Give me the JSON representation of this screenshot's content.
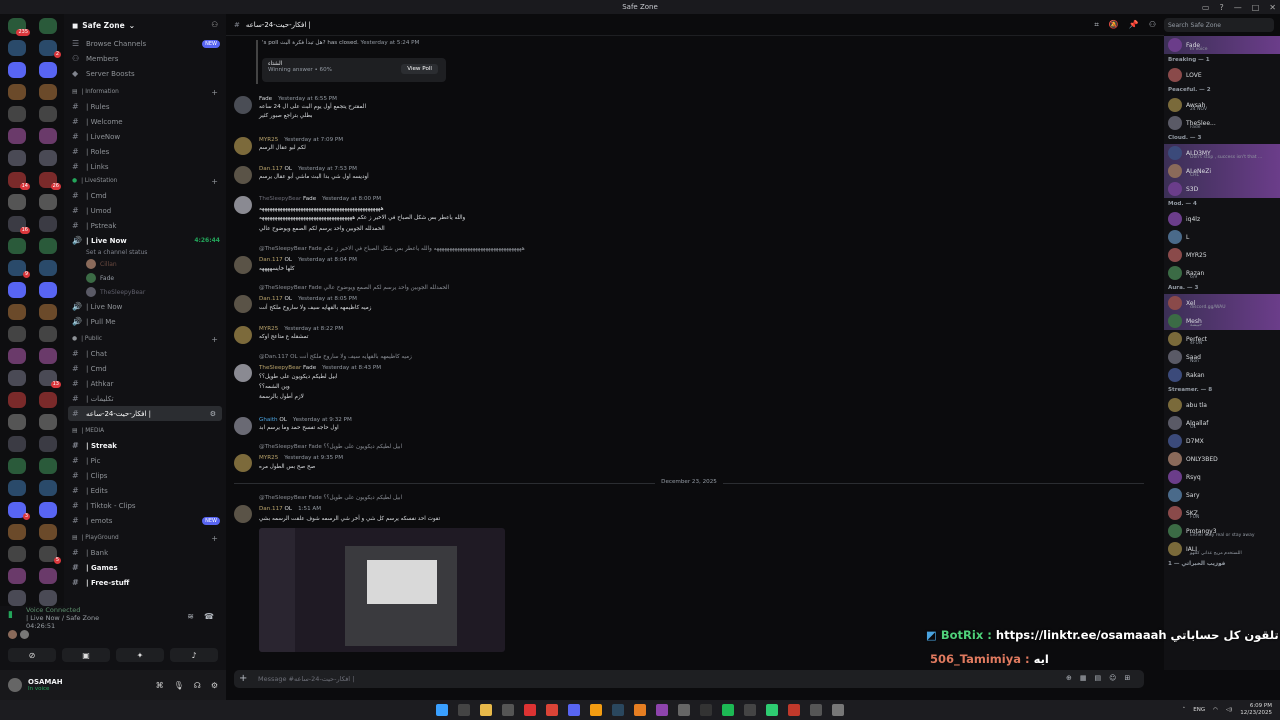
{
  "window": {
    "title": "Safe Zone"
  },
  "servers": {
    "col1_badges": [
      "235",
      "",
      "",
      "",
      "",
      "",
      "",
      "14",
      "",
      "16",
      "",
      "9",
      "",
      "",
      "",
      "",
      "",
      "",
      "",
      "",
      "",
      "",
      "3",
      "",
      "",
      "",
      "",
      "",
      "",
      "",
      "",
      "",
      "",
      "",
      "",
      "",
      "",
      "NEW"
    ],
    "col2_badges": [
      "",
      "2",
      "",
      "",
      "",
      "",
      "",
      "26",
      "",
      "",
      "",
      "",
      "",
      "",
      "",
      "",
      "13",
      "",
      "",
      "",
      "",
      "",
      "",
      "",
      "5",
      "",
      "",
      "",
      "",
      "",
      "",
      "",
      "",
      "",
      "",
      "",
      "",
      ""
    ]
  },
  "sidebar": {
    "guild_name": "Safe Zone",
    "top_items": [
      {
        "label": "Browse Channels",
        "badge": "NEW"
      },
      {
        "label": "Members",
        "badge": ""
      },
      {
        "label": "Server Boosts",
        "badge": ""
      }
    ],
    "categories": [
      {
        "name": "| Information",
        "channels": [
          "| Rules",
          "| Welcome",
          "| LiveNow",
          "| Roles",
          "| Links"
        ]
      },
      {
        "name": "| LiveStation",
        "channels": [
          "| Cmd",
          "| Umod",
          "| Pstreak"
        ]
      },
      {
        "name": "| Public",
        "channels": [
          "| Chat",
          "| Cmd",
          "| Athkar",
          "| تكليمات"
        ]
      },
      {
        "name": "| MEDIA",
        "channels": [
          "| Streak",
          "| Pic",
          "| Clips",
          "| Edits",
          "| Tiktok - Clips",
          "| emots"
        ]
      },
      {
        "name": "| PlayGround",
        "channels": [
          "| Bank",
          "| Games",
          "| Free-stuff"
        ]
      }
    ],
    "live_now": {
      "label": "| Live Now",
      "timer": "4:26:44",
      "status": "Set a channel status"
    },
    "live_users": [
      "Cillan",
      "Fade",
      "TheSleepyBear"
    ],
    "voice_channels": [
      "| Live Now",
      "| Pull Me"
    ],
    "active_channel": "افكار-حيت-24-ساعه |",
    "emots_badge": "NEW"
  },
  "voice": {
    "title": "Voice Connected",
    "channel": "| Live Now / Safe Zone",
    "timer": "04:26:51"
  },
  "user": {
    "name": "OSAMAH",
    "status": "In voice"
  },
  "chat": {
    "channel_title": "افكار-حيت-24-ساعه |",
    "poll": {
      "line": "'s poll هل تبدأ فكرة البث? has closed.",
      "time": "Yesterday at 5:24 PM",
      "winner": "الشتاء",
      "winner_sub": "Winning answer • 60%",
      "button": "View Poll"
    },
    "messages": [
      {
        "name": "",
        "badge": "Fade",
        "time": "Yesterday at 6:55 PM",
        "lines": [
          "المقترح يتجمع أول يوم البث على ال 24 ساعه",
          "بطلي بتراجع صبور كثير"
        ]
      },
      {
        "name": "MYR25",
        "badge": "",
        "time": "Yesterday at 7:09 PM",
        "lines": [
          "لكم لبو عقال الرسم"
        ]
      },
      {
        "name": "Dan.117",
        "badge": "OL",
        "time": "Yesterday at 7:53 PM",
        "lines": [
          "أوديسه اول شي بدا البث ماشي أبو عقال يرسم"
        ]
      },
      {
        "name": "TheSleepyBear",
        "badge": "Fade",
        "time": "Yesterday at 8:00 PM",
        "lines": [
          "هههههههههههههههههههههههههههههههههههههههههههههههه",
          "والله ياعطر بس شكل الصباح في الاخير ز عكم ههههههههههههههههههههههههههههههههههههه",
          "الحمدلله الجوبين واحد يرسم لكم الصمع ويوضوح عالي"
        ]
      },
      {
        "name": "Dan.117",
        "badge": "OL",
        "time": "Yesterday at 8:04 PM",
        "reply": "@TheSleepyBear Fade ههههههههههههههههههههههههههههههههههه والله ياعطر بس شكل الصباح في الاخير ز عكم",
        "lines": [
          "كلها خايسههههه"
        ]
      },
      {
        "name": "Dan.117",
        "badge": "OL",
        "time": "Yesterday at 8:05 PM",
        "reply": "@TheSleepyBear Fade الحمدلله الجوبين واحد يرسم لكم الصمع ويوضوح عالي",
        "lines": [
          "زميه كاظيمهه بالقهايه سيف ولا ساروخ ملكح أنت"
        ]
      },
      {
        "name": "MYR25",
        "badge": "",
        "time": "Yesterday at 8:22 PM",
        "lines": [
          "تمشقله ع متاعج اوكه"
        ]
      },
      {
        "name": "TheSleepyBear",
        "badge": "Fade",
        "time": "Yesterday at 8:43 PM",
        "reply": "@Dan.117 OL زميه كاظيمهه بالقهايه سيف ولا ساروخ ملكح أنت",
        "lines": [
          "ابيل لطيكم ديكويون على طويل؟؟",
          "وين الشمه؟؟",
          "لازم أطول بالرسمة"
        ]
      },
      {
        "name": "Ghaith",
        "badge": "OL",
        "time": "Yesterday at 9:32 PM",
        "lines": [
          "اول حاجه تفسح حمد وما يرسم ابد"
        ]
      },
      {
        "name": "MYR25",
        "badge": "",
        "time": "Yesterday at 9:35 PM",
        "reply": "@TheSleepyBear Fade ابيل لطيكم ديكويون على طويل؟؟",
        "lines": [
          "صح صح بس الطول مره"
        ]
      },
      {
        "name": "Dan.117",
        "badge": "OL",
        "time": "1:51 AM",
        "reply": "@TheSleepyBear Fade ابيل لطيكم ديكويون على طويل؟؟",
        "lines": [
          "تقوت احد نفسكه يرسم كل شي و أخر شي الرسمه شوف علقت الرسمه بشي"
        ]
      }
    ],
    "date_divider": "December 23, 2025",
    "composer_placeholder": "Message #افكار-حيت-24-ساعه |"
  },
  "members": {
    "search_placeholder": "Search Safe Zone",
    "groups": [
      {
        "title": "",
        "items": [
          {
            "name": "Fade",
            "status": "In voice"
          }
        ]
      },
      {
        "title": "Breaking — 1",
        "items": [
          {
            "name": "LOVE",
            "status": ""
          }
        ]
      },
      {
        "title": "Peaceful. — 2",
        "items": [
          {
            "name": "Awsah",
            "status": "24 NOV"
          },
          {
            "name": "TheSlee...",
            "status": "Fade"
          }
        ]
      },
      {
        "title": "Cloud. — 3",
        "items": [
          {
            "name": "ALD3MY",
            "status": "Don't stop , success isn't that ..."
          },
          {
            "name": "ALeNeZi",
            "status": "CHL"
          },
          {
            "name": "S3D",
            "status": ""
          }
        ]
      },
      {
        "title": "Mod. — 4",
        "items": [
          {
            "name": "iq4lz",
            "status": ""
          },
          {
            "name": "L",
            "status": ""
          },
          {
            "name": "MYR25",
            "status": ""
          },
          {
            "name": "Razan",
            "status": "6/9"
          }
        ]
      },
      {
        "title": "Aura. — 3",
        "items": [
          {
            "name": "Xel",
            "status": "discord.gg/WAU"
          },
          {
            "name": "Mesh",
            "status": "حبيشة"
          },
          {
            "name": "Perfect",
            "status": "4FUN"
          },
          {
            "name": "Saad",
            "status": "Non"
          },
          {
            "name": "Rakan",
            "status": ""
          }
        ]
      },
      {
        "title": "Streamer. — 8",
        "items": [
          {
            "name": "abu tla",
            "status": ""
          },
          {
            "name": "Alqallaf",
            "status": "OL"
          },
          {
            "name": "D7MX",
            "status": ""
          },
          {
            "name": "ONLY3BED",
            "status": ""
          },
          {
            "name": "Rsyq",
            "status": ""
          },
          {
            "name": "Sary",
            "status": ""
          },
          {
            "name": "SKZ",
            "status": "FUN"
          },
          {
            "name": "Protangy3",
            "status": "Either stay real or stay away"
          },
          {
            "name": "IALI",
            "status": "اللستخدم مزيج عذاني كللهو"
          }
        ]
      },
      {
        "title": "فوزيب الخبراتي — 1",
        "items": []
      }
    ]
  },
  "overlay": {
    "line1_prefix": "هنا تلقون كل حساباتي |",
    "bot_name": "BotRix :",
    "link": "https://linktr.ee/osamaaah",
    "line2_user": "506_Tamimiya :",
    "line2_text": "ايه"
  },
  "taskbar": {
    "lang": "ENG",
    "time": "6:09 PM",
    "date": "12/23/2025"
  },
  "colors": {
    "accent": "#5865f2",
    "online": "#23a55a",
    "danger": "#da373c",
    "bot": "#4fd17a"
  }
}
